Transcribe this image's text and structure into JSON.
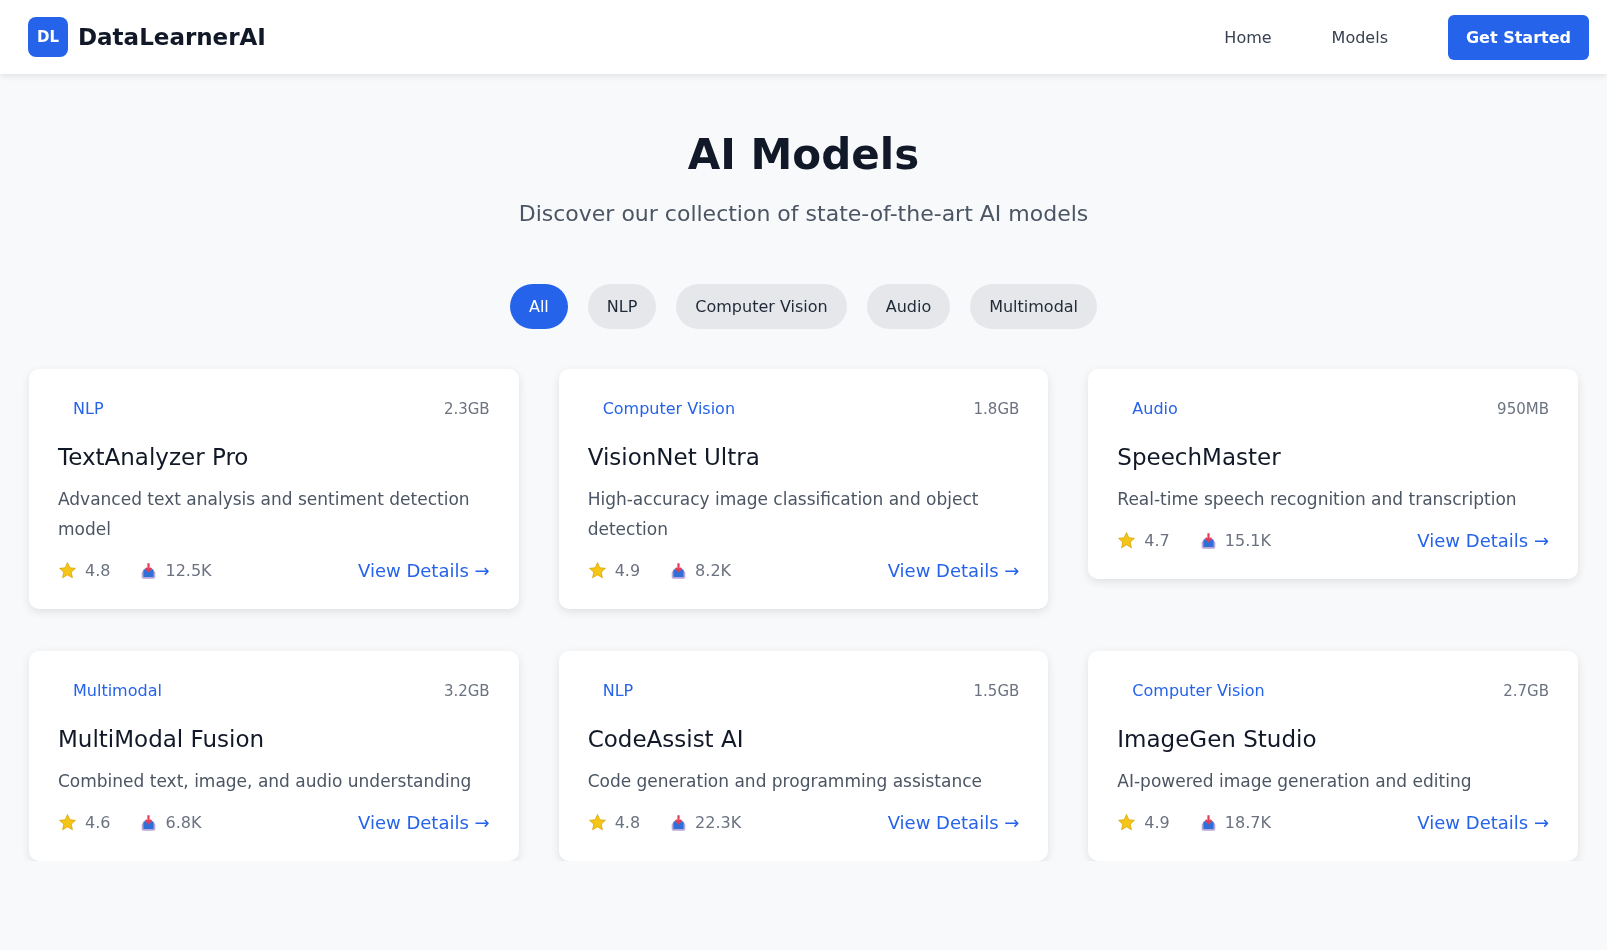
{
  "header": {
    "logo_mark": "DL",
    "brand": "DataLearnerAI",
    "nav": [
      {
        "label": "Home"
      },
      {
        "label": "Models"
      }
    ],
    "cta": "Get Started"
  },
  "hero": {
    "title": "AI Models",
    "subtitle": "Discover our collection of state-of-the-art AI models"
  },
  "filters": [
    {
      "label": "All",
      "selected": true
    },
    {
      "label": "NLP",
      "selected": false
    },
    {
      "label": "Computer Vision",
      "selected": false
    },
    {
      "label": "Audio",
      "selected": false
    },
    {
      "label": "Multimodal",
      "selected": false
    }
  ],
  "models": [
    {
      "category": "NLP",
      "size": "2.3GB",
      "name": "TextAnalyzer Pro",
      "description": "Advanced text analysis and sentiment detection model",
      "rating": "4.8",
      "downloads": "12.5K",
      "link": "View Details →"
    },
    {
      "category": "Computer Vision",
      "size": "1.8GB",
      "name": "VisionNet Ultra",
      "description": "High-accuracy image classification and object detection",
      "rating": "4.9",
      "downloads": "8.2K",
      "link": "View Details →"
    },
    {
      "category": "Audio",
      "size": "950MB",
      "name": "SpeechMaster",
      "description": "Real-time speech recognition and transcription",
      "rating": "4.7",
      "downloads": "15.1K",
      "link": "View Details →"
    },
    {
      "category": "Multimodal",
      "size": "3.2GB",
      "name": "MultiModal Fusion",
      "description": "Combined text, image, and audio understanding",
      "rating": "4.6",
      "downloads": "6.8K",
      "link": "View Details →"
    },
    {
      "category": "NLP",
      "size": "1.5GB",
      "name": "CodeAssist AI",
      "description": "Code generation and programming assistance",
      "rating": "4.8",
      "downloads": "22.3K",
      "link": "View Details →"
    },
    {
      "category": "Computer Vision",
      "size": "2.7GB",
      "name": "ImageGen Studio",
      "description": "AI-powered image generation and editing",
      "rating": "4.9",
      "downloads": "18.7K",
      "link": "View Details →"
    }
  ]
}
